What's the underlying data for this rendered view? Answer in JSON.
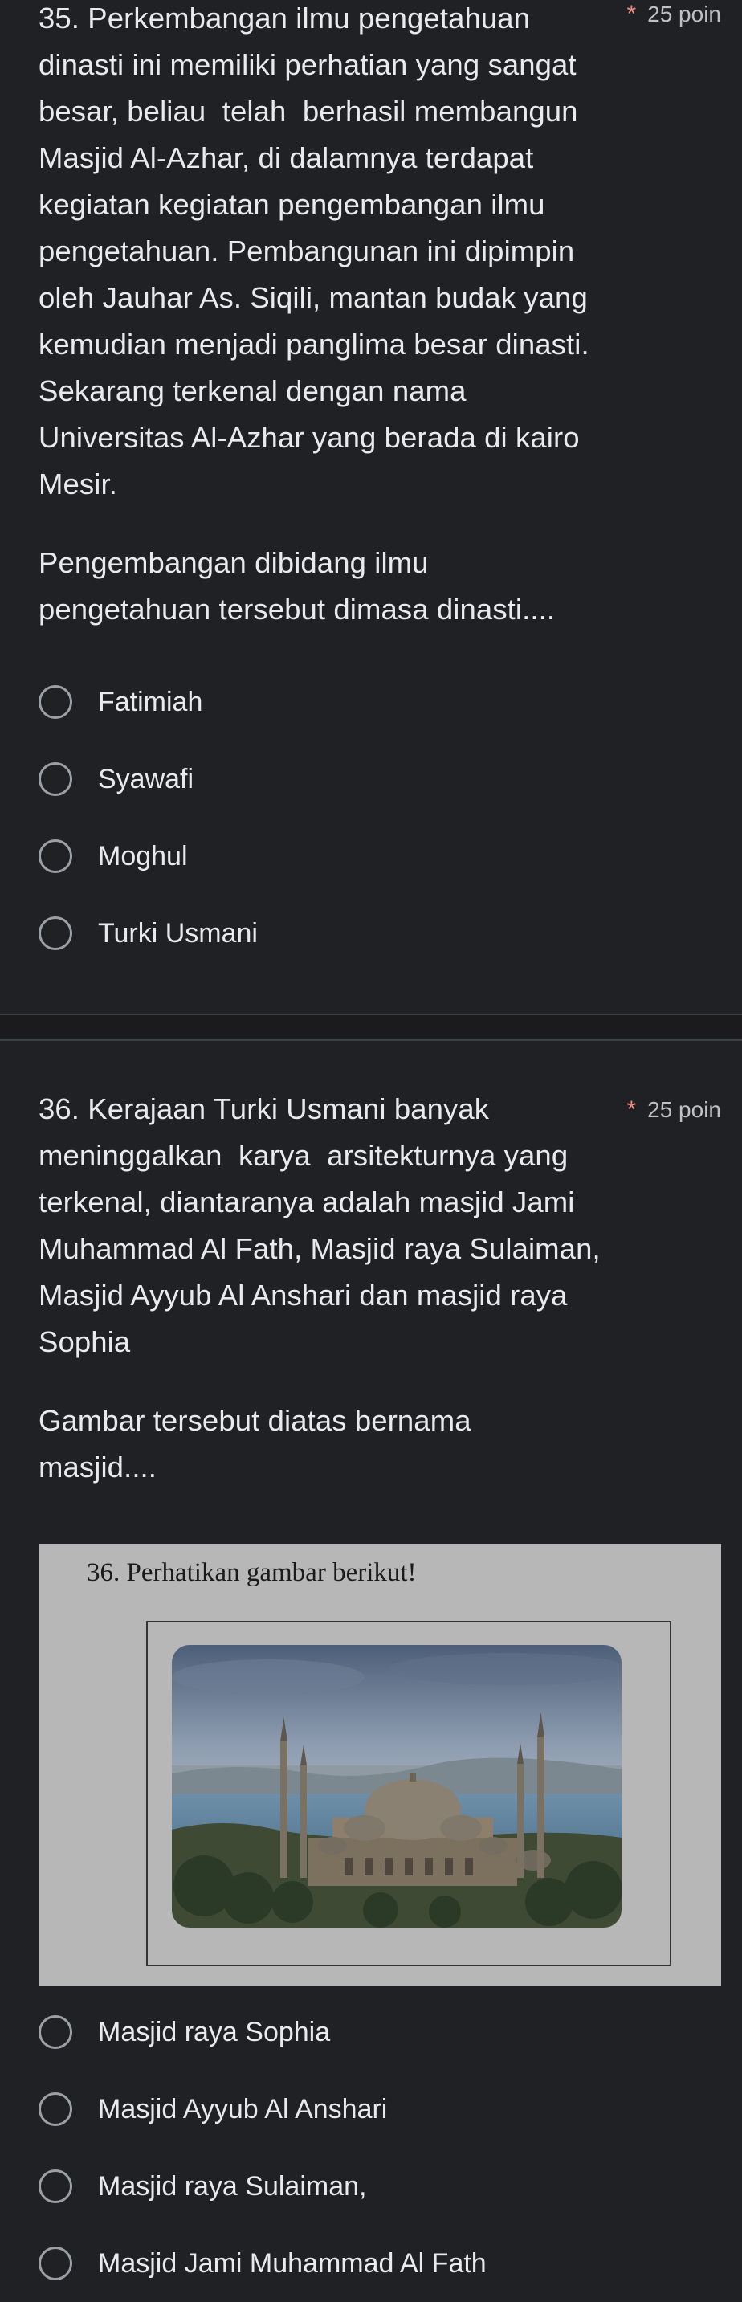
{
  "q35": {
    "text_line1": "35. Perkembangan ilmu pengetahuan",
    "text_rest": "dinasti ini memiliki perhatian yang sangat besar, beliau  telah  berhasil membangun Masjid Al-Azhar, di dalamnya terdapat kegiatan kegiatan pengembangan ilmu pengetahuan. Pembangunan ini dipimpin oleh Jauhar As. Siqili, mantan budak yang kemudian menjadi panglima besar dinasti. Sekarang terkenal dengan nama Universitas Al-Azhar yang berada di kairo Mesir.",
    "prompt": "Pengembangan dibidang ilmu pengetahuan tersebut dimasa dinasti....",
    "points_label": "25 poin",
    "required_mark": "*",
    "options": [
      "Fatimiah",
      "Syawafi",
      "Moghul",
      "Turki Usmani"
    ]
  },
  "q36": {
    "text_line1": "36. Kerajaan Turki Usmani banyak",
    "text_rest": "meninggalkan  karya  arsitekturnya yang terkenal, diantaranya adalah masjid Jami Muhammad Al Fath, Masjid raya Sulaiman, Masjid Ayyub Al Anshari dan masjid raya Sophia",
    "prompt": "Gambar tersebut diatas bernama masjid....",
    "points_label": "25 poin",
    "required_mark": "*",
    "image_caption": "36. Perhatikan gambar berikut!",
    "options": [
      "Masjid raya Sophia",
      "Masjid Ayyub Al Anshari",
      "Masjid raya Sulaiman,",
      "Masjid Jami Muhammad Al Fath"
    ]
  },
  "colors": {
    "background": "#202124",
    "text": "#e8eaed",
    "required_star": "#f28b82",
    "radio_border": "#9aa0a6"
  }
}
